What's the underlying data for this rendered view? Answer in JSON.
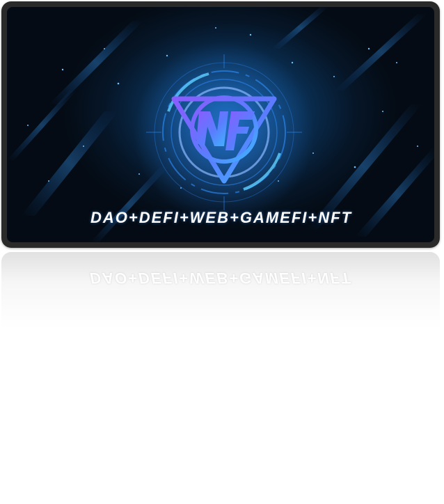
{
  "banner": {
    "tagline": "DAO+DEFI+WEB+GAMEFI+NFT",
    "logo_name": "triangle-shield-logo-icon"
  },
  "colors": {
    "frame": "#2a2a2a",
    "background_dark": "#040b14",
    "background_glow": "#0f4d86",
    "logo_purple": "#7b5cff",
    "logo_blue": "#3fa9ff",
    "text": "#ffffff"
  }
}
